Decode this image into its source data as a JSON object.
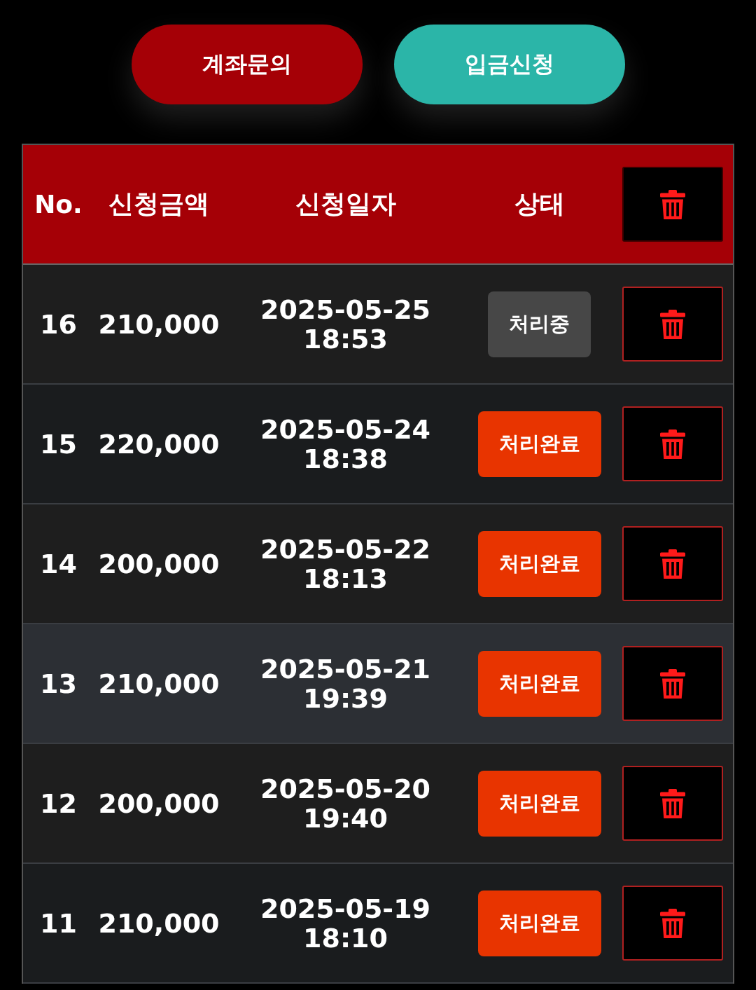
{
  "actions": [
    {
      "label": "계좌문의",
      "kind": "inquiry"
    },
    {
      "label": "입금신청",
      "kind": "deposit"
    }
  ],
  "table": {
    "columns": [
      "No.",
      "신청금액",
      "신청일자",
      "상태"
    ],
    "rows": [
      {
        "no": "16",
        "amount": "210,000",
        "date": "2025-05-25 18:53",
        "status": "처리중",
        "kind": "processing",
        "selected": false
      },
      {
        "no": "15",
        "amount": "220,000",
        "date": "2025-05-24 18:38",
        "status": "처리완료",
        "kind": "done",
        "selected": false
      },
      {
        "no": "14",
        "amount": "200,000",
        "date": "2025-05-22 18:13",
        "status": "처리완료",
        "kind": "done",
        "selected": false
      },
      {
        "no": "13",
        "amount": "210,000",
        "date": "2025-05-21 19:39",
        "status": "처리완료",
        "kind": "done",
        "selected": true
      },
      {
        "no": "12",
        "amount": "200,000",
        "date": "2025-05-20 19:40",
        "status": "처리완료",
        "kind": "done",
        "selected": false
      },
      {
        "no": "11",
        "amount": "210,000",
        "date": "2025-05-19 18:10",
        "status": "처리완료",
        "kind": "done",
        "selected": false
      }
    ]
  }
}
